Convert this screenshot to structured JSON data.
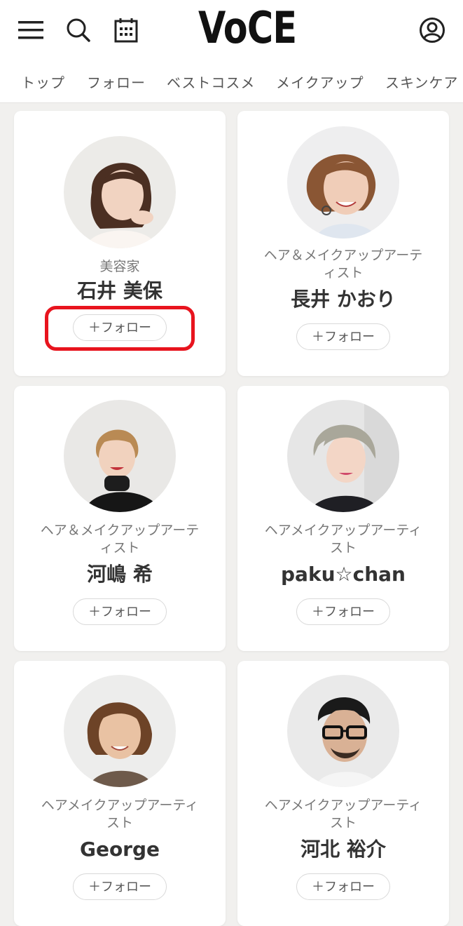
{
  "header": {
    "logo": "VoCE",
    "icons": [
      "menu-icon",
      "search-icon",
      "calendar-icon",
      "account-icon"
    ]
  },
  "tabs": [
    {
      "label": "トップ"
    },
    {
      "label": "フォロー"
    },
    {
      "label": "ベストコスメ"
    },
    {
      "label": "メイクアップ"
    },
    {
      "label": "スキンケア"
    }
  ],
  "cards": [
    {
      "role": "美容家",
      "name": "石井 美保",
      "follow": "＋フォロー",
      "highlighted": true
    },
    {
      "role": "ヘア＆メイクアップアーティスト",
      "role_lines": [
        "ヘア＆メイクアップアーテ",
        "ィスト"
      ],
      "name": "長井 かおり",
      "follow": "＋フォロー"
    },
    {
      "role": "ヘア＆メイクアップアーティスト",
      "role_lines": [
        "ヘア＆メイクアップアーテ",
        "ィスト"
      ],
      "name": "河嶋 希",
      "follow": "＋フォロー"
    },
    {
      "role": "ヘアメイクアップアーティスト",
      "role_lines": [
        "ヘアメイクアップアーティ",
        "スト"
      ],
      "name": "paku☆chan",
      "follow": "＋フォロー"
    },
    {
      "role": "ヘアメイクアップアーティスト",
      "role_lines": [
        "ヘアメイクアップアーティ",
        "スト"
      ],
      "name": "George",
      "follow": "＋フォロー"
    },
    {
      "role": "ヘアメイクアップアーティスト",
      "role_lines": [
        "ヘアメイクアップアーティ",
        "スト"
      ],
      "name": "河北 裕介",
      "follow": "＋フォロー"
    }
  ],
  "colors": {
    "background": "#f1f0ee",
    "highlight": "#e8141e"
  }
}
